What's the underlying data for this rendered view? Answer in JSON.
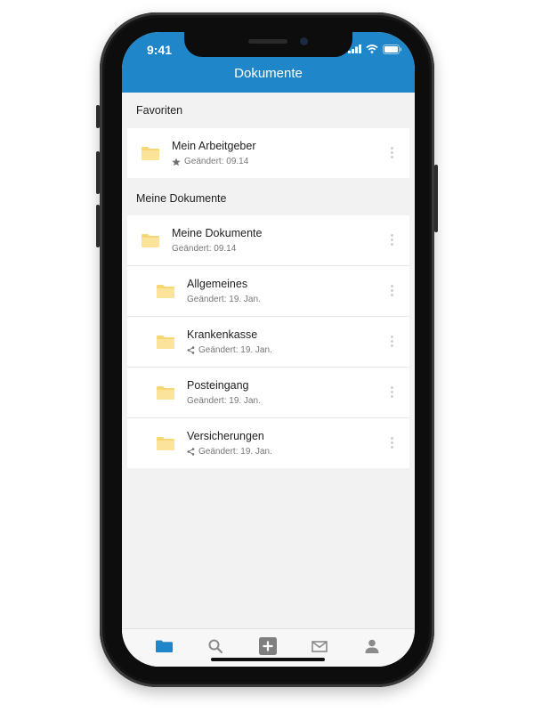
{
  "status": {
    "time": "9:41"
  },
  "header": {
    "title": "Dokumente"
  },
  "sections": {
    "favorites": "Favoriten",
    "documents": "Meine Dokumente"
  },
  "favorites": [
    {
      "name": "Mein Arbeitgeber",
      "meta": "Geändert: 09.14",
      "meta_icon": "star-icon"
    }
  ],
  "documents": [
    {
      "name": "Meine Dokumente",
      "meta": "Geändert: 09.14",
      "meta_icon": ""
    },
    {
      "name": "Allgemeines",
      "meta": "Geändert: 19. Jan.",
      "meta_icon": ""
    },
    {
      "name": "Krankenkasse",
      "meta": "Geändert: 19. Jan.",
      "meta_icon": "share-icon"
    },
    {
      "name": "Posteingang",
      "meta": "Geändert: 19. Jan.",
      "meta_icon": ""
    },
    {
      "name": "Versicherungen",
      "meta": "Geändert: 19. Jan.",
      "meta_icon": "share-icon"
    }
  ],
  "tabbar": {
    "items": [
      "folder-icon",
      "search-icon",
      "add-icon",
      "mail-icon",
      "profile-icon"
    ],
    "active": "folder-icon"
  },
  "colors": {
    "header": "#1f87c9",
    "folder": "#f7d774",
    "active_tab": "#1f87c9",
    "inactive_tab": "#8a8a8a"
  }
}
